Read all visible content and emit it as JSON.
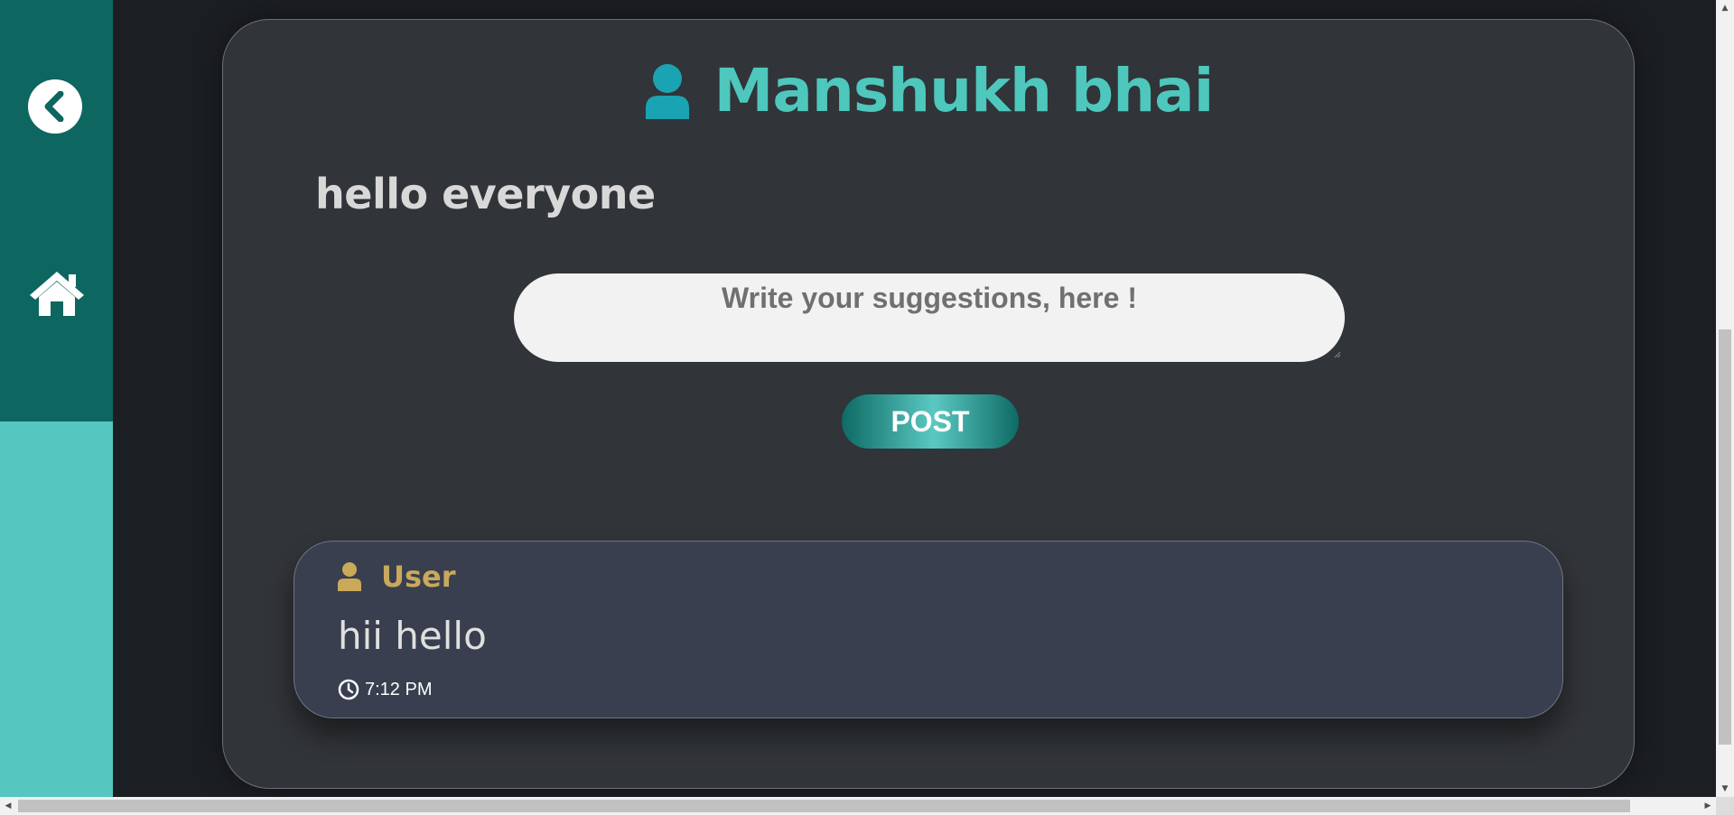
{
  "colors": {
    "sidebar_top": "#0e6660",
    "sidebar_bottom": "#56c7c0",
    "background": "#1b1e22",
    "card": "#313438",
    "title_accent": "#4ec7bd",
    "title_icon": "#1aa3b3",
    "comment_bg": "#3a3f4f",
    "comment_user": "#c9a95a"
  },
  "sidebar": {
    "back_icon": "chevron-left-circle-icon",
    "home_icon": "home-icon"
  },
  "header": {
    "icon": "user-icon",
    "title": "Manshukh bhai"
  },
  "post": {
    "text": "hello everyone"
  },
  "suggestion_form": {
    "placeholder": "Write your suggestions, here !",
    "value": "",
    "submit_label": "POST"
  },
  "comments": [
    {
      "user_icon": "user-icon",
      "user": "User",
      "text": "hii hello",
      "time_icon": "clock-icon",
      "time": "7:12 PM"
    }
  ],
  "scrollbars": {
    "vertical": "visible",
    "horizontal": "visible"
  }
}
